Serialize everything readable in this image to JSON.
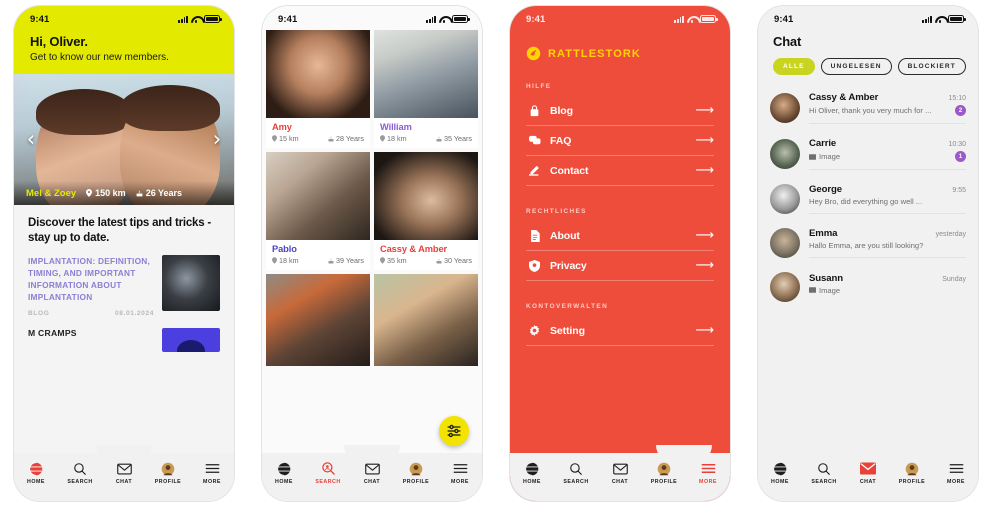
{
  "status_bar": {
    "time": "9:41",
    "signal_icon": "signal-bars-icon",
    "wifi_icon": "wifi-icon",
    "battery_icon": "battery-icon"
  },
  "brand": {
    "name": "RATTLESTORK",
    "logo_icon": "stork-logo-icon",
    "yellow": "#ffd400",
    "red": "#ef4d3c",
    "lime": "#e3ea00",
    "purple": "#8b7fd4",
    "badge_purple": "#9b59c9"
  },
  "tabbar": {
    "items": [
      {
        "label": "HOME",
        "icon": "globe-icon"
      },
      {
        "label": "SEARCH",
        "icon": "search-icon"
      },
      {
        "label": "CHAT",
        "icon": "envelope-icon"
      },
      {
        "label": "PROFILE",
        "icon": "avatar-icon"
      },
      {
        "label": "MORE",
        "icon": "hamburger-icon"
      }
    ]
  },
  "screen_home": {
    "active_tab": "HOME",
    "greeting_title": "Hi, Oliver.",
    "greeting_subtitle": "Get to know our new members.",
    "carousel": {
      "prev_icon": "chevron-left-icon",
      "next_icon": "chevron-right-icon",
      "name": "Mel & Zoey",
      "distance_icon": "location-pin-icon",
      "distance": "150 km",
      "age_icon": "cake-icon",
      "age": "26 Years"
    },
    "blog_heading": "Discover the latest tips and tricks - stay up to date.",
    "posts": [
      {
        "title": "IMPLANTATION: DEFINITION, TIMING, AND IMPORTANT INFORMATION ABOUT IMPLANTATION",
        "category": "BLOG",
        "date": "08.01.2024"
      },
      {
        "title": "M CRAMPS"
      }
    ]
  },
  "screen_grid": {
    "active_tab": "SEARCH",
    "filter_button_icon": "sliders-filter-icon",
    "cards": [
      {
        "name": "Amy",
        "name_color": "#e8413a",
        "distance_icon": "location-pin-icon",
        "distance": "15 km",
        "age_icon": "cake-icon",
        "age": "28 Years"
      },
      {
        "name": "William",
        "name_color": "#8b5cd6",
        "distance_icon": "location-pin-icon",
        "distance": "18 km",
        "age_icon": "cake-icon",
        "age": "35 Years"
      },
      {
        "name": "Pablo",
        "name_color": "#4b44c4",
        "distance_icon": "location-pin-icon",
        "distance": "18 km",
        "age_icon": "cake-icon",
        "age": "39 Years"
      },
      {
        "name": "Cassy & Amber",
        "name_color": "#e8413a",
        "distance_icon": "location-pin-icon",
        "distance": "35 km",
        "age_icon": "cake-icon",
        "age": "30 Years"
      },
      {
        "name": "",
        "name_color": "#e8413a",
        "distance": "",
        "age": ""
      },
      {
        "name": "",
        "name_color": "#e8413a",
        "distance": "",
        "age": ""
      }
    ]
  },
  "screen_menu": {
    "active_tab": "MORE",
    "sections": [
      {
        "title": "HILFE",
        "items": [
          {
            "label": "Blog",
            "icon": "book-lock-icon",
            "arrow_icon": "arrow-right-icon"
          },
          {
            "label": "FAQ",
            "icon": "chat-bubbles-icon",
            "arrow_icon": "arrow-right-icon"
          },
          {
            "label": "Contact",
            "icon": "pencil-edit-icon",
            "arrow_icon": "arrow-right-icon"
          }
        ]
      },
      {
        "title": "RECHTLICHES",
        "items": [
          {
            "label": "About",
            "icon": "document-icon",
            "arrow_icon": "arrow-right-icon"
          },
          {
            "label": "Privacy",
            "icon": "shield-icon",
            "arrow_icon": "arrow-right-icon"
          }
        ]
      },
      {
        "title": "KONTOVERWALTEN",
        "items": [
          {
            "label": "Setting",
            "icon": "gear-icon",
            "arrow_icon": "arrow-right-icon"
          }
        ]
      }
    ]
  },
  "screen_chat": {
    "active_tab": "CHAT",
    "title": "Chat",
    "filters": [
      {
        "label": "ALLE",
        "active": true
      },
      {
        "label": "UNGELESEN",
        "active": false
      },
      {
        "label": "BLOCKIERT",
        "active": false
      }
    ],
    "conversations": [
      {
        "name": "Cassy & Amber",
        "preview": "Hi Oliver, thank you very much for  ...",
        "time": "15:10",
        "unread": "2",
        "attachment_icon": ""
      },
      {
        "name": "Carrie",
        "preview": "Image",
        "time": "10:30",
        "unread": "1",
        "attachment_icon": "image-icon"
      },
      {
        "name": "George",
        "preview": "Hey Bro, did everything go well ...",
        "time": "9:55",
        "unread": "",
        "attachment_icon": ""
      },
      {
        "name": "Emma",
        "preview": "Hallo Emma, are you still looking?",
        "time": "yesterday",
        "unread": "",
        "attachment_icon": ""
      },
      {
        "name": "Susann",
        "preview": "Image",
        "time": "Sunday",
        "unread": "",
        "attachment_icon": "image-icon"
      }
    ]
  }
}
